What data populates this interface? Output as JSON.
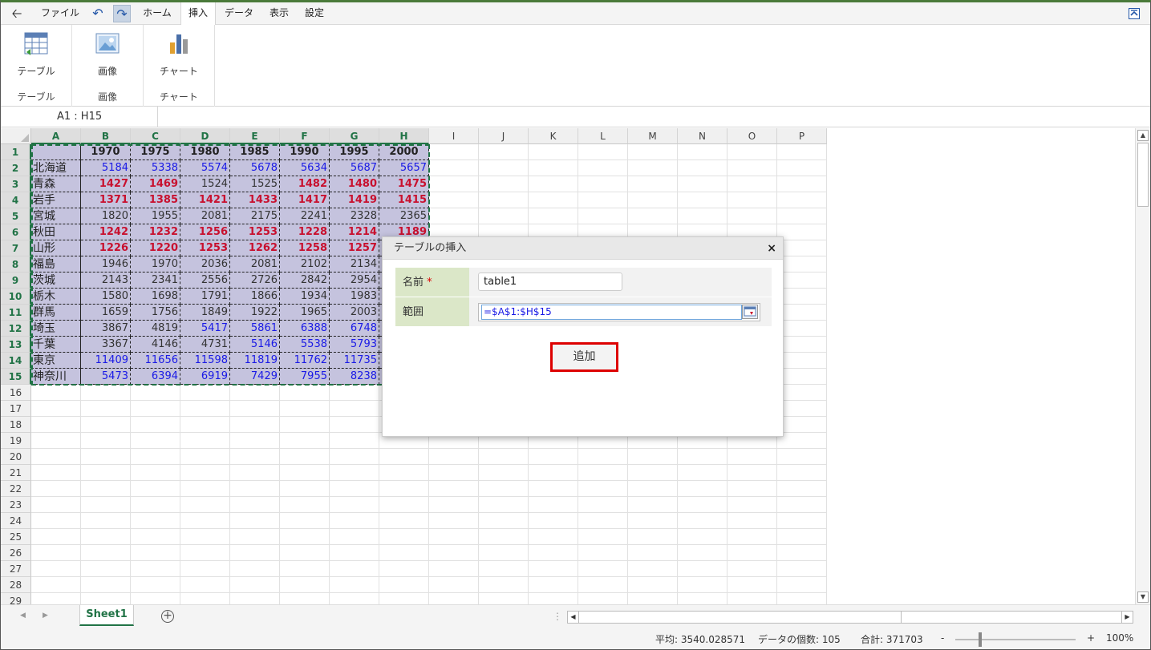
{
  "menubar": {
    "file": "ファイル",
    "tabs": [
      "ホーム",
      "挿入",
      "データ",
      "表示",
      "設定"
    ],
    "active_tab": "挿入"
  },
  "ribbon": {
    "groups": [
      {
        "button": "テーブル",
        "group": "テーブル"
      },
      {
        "button": "画像",
        "group": "画像"
      },
      {
        "button": "チャート",
        "group": "チャート"
      }
    ]
  },
  "namebox": "A1 : H15",
  "sheet": {
    "columns": [
      "A",
      "B",
      "C",
      "D",
      "E",
      "F",
      "G",
      "H",
      "I",
      "J",
      "K",
      "L",
      "M",
      "N",
      "O",
      "P"
    ],
    "rows": [
      "1",
      "2",
      "3",
      "4",
      "5",
      "6",
      "7",
      "8",
      "9",
      "10",
      "11",
      "12",
      "13",
      "14",
      "15",
      "16",
      "17",
      "18",
      "19",
      "20",
      "21",
      "22",
      "23",
      "24",
      "25",
      "26",
      "27",
      "28",
      "29"
    ],
    "header_years": [
      "1970",
      "1975",
      "1980",
      "1985",
      "1990",
      "1995",
      "2000"
    ],
    "table": [
      {
        "pref": "北海道",
        "values": [
          "5184",
          "5338",
          "5574",
          "5678",
          "5634",
          "5687",
          "5657"
        ],
        "colors": [
          "blue",
          "blue",
          "blue",
          "blue",
          "blue",
          "blue",
          "blue"
        ]
      },
      {
        "pref": "青森",
        "values": [
          "1427",
          "1469",
          "1524",
          "1525",
          "1482",
          "1480",
          "1475"
        ],
        "colors": [
          "red",
          "red",
          "dark",
          "dark",
          "red",
          "red",
          "red"
        ]
      },
      {
        "pref": "岩手",
        "values": [
          "1371",
          "1385",
          "1421",
          "1433",
          "1417",
          "1419",
          "1415"
        ],
        "colors": [
          "red",
          "red",
          "red",
          "red",
          "red",
          "red",
          "red"
        ]
      },
      {
        "pref": "宮城",
        "values": [
          "1820",
          "1955",
          "2081",
          "2175",
          "2241",
          "2328",
          "2365"
        ],
        "colors": [
          "dark",
          "dark",
          "dark",
          "dark",
          "dark",
          "dark",
          "dark"
        ]
      },
      {
        "pref": "秋田",
        "values": [
          "1242",
          "1232",
          "1256",
          "1253",
          "1228",
          "1214",
          "1189"
        ],
        "colors": [
          "red",
          "red",
          "red",
          "red",
          "red",
          "red",
          "red"
        ]
      },
      {
        "pref": "山形",
        "values": [
          "1226",
          "1220",
          "1253",
          "1262",
          "1258",
          "1257",
          ""
        ],
        "colors": [
          "red",
          "red",
          "red",
          "red",
          "red",
          "red",
          "red"
        ]
      },
      {
        "pref": "福島",
        "values": [
          "1946",
          "1970",
          "2036",
          "2081",
          "2102",
          "2134",
          ""
        ],
        "colors": [
          "dark",
          "dark",
          "dark",
          "dark",
          "dark",
          "dark",
          "dark"
        ]
      },
      {
        "pref": "茨城",
        "values": [
          "2143",
          "2341",
          "2556",
          "2726",
          "2842",
          "2954",
          ""
        ],
        "colors": [
          "dark",
          "dark",
          "dark",
          "dark",
          "dark",
          "dark",
          "dark"
        ]
      },
      {
        "pref": "栃木",
        "values": [
          "1580",
          "1698",
          "1791",
          "1866",
          "1934",
          "1983",
          ""
        ],
        "colors": [
          "dark",
          "dark",
          "dark",
          "dark",
          "dark",
          "dark",
          "dark"
        ]
      },
      {
        "pref": "群馬",
        "values": [
          "1659",
          "1756",
          "1849",
          "1922",
          "1965",
          "2003",
          ""
        ],
        "colors": [
          "dark",
          "dark",
          "dark",
          "dark",
          "dark",
          "dark",
          "dark"
        ]
      },
      {
        "pref": "埼玉",
        "values": [
          "3867",
          "4819",
          "5417",
          "5861",
          "6388",
          "6748",
          ""
        ],
        "colors": [
          "dark",
          "dark",
          "blue",
          "blue",
          "blue",
          "blue",
          "blue"
        ]
      },
      {
        "pref": "千葉",
        "values": [
          "3367",
          "4146",
          "4731",
          "5146",
          "5538",
          "5793",
          ""
        ],
        "colors": [
          "dark",
          "dark",
          "dark",
          "blue",
          "blue",
          "blue",
          "blue"
        ]
      },
      {
        "pref": "東京",
        "values": [
          "11409",
          "11656",
          "11598",
          "11819",
          "11762",
          "11735",
          ""
        ],
        "colors": [
          "blue",
          "blue",
          "blue",
          "blue",
          "blue",
          "blue",
          "blue"
        ]
      },
      {
        "pref": "神奈川",
        "values": [
          "5473",
          "6394",
          "6919",
          "7429",
          "7955",
          "8238",
          ""
        ],
        "colors": [
          "blue",
          "blue",
          "blue",
          "blue",
          "blue",
          "blue",
          "blue"
        ]
      }
    ]
  },
  "dialog": {
    "title": "テーブルの挿入",
    "close": "×",
    "name_label": "名前",
    "required_mark": "*",
    "name_value": "table1",
    "range_label": "範囲",
    "range_value": "=$A$1:$H$15",
    "add_button": "追加"
  },
  "sheetbar": {
    "sheet_tab": "Sheet1",
    "add_sheet": "+"
  },
  "status": {
    "average": "平均: 3540.028571",
    "count": "データの個数: 105",
    "sum": "合計: 371703",
    "zoom_minus": "-",
    "zoom_plus": "+",
    "zoom": "100%"
  },
  "colors": {
    "accent": "#217346",
    "table_fill": "#c5c3de",
    "blue_text": "#1a1ae6",
    "red_text": "#c8102e"
  }
}
